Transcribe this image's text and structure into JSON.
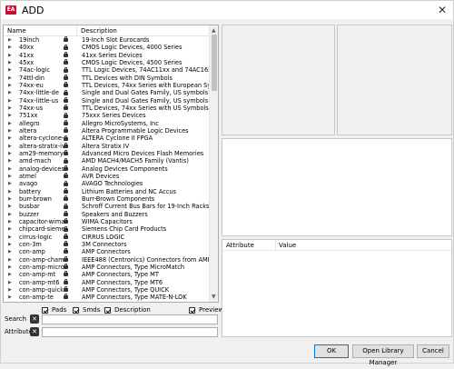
{
  "window": {
    "title": "ADD",
    "close": "✕"
  },
  "library_list": {
    "columns": {
      "name": "Name",
      "description": "Description"
    },
    "rows": [
      {
        "name": "19inch",
        "description": "19-Inch Slot Eurocards"
      },
      {
        "name": "40xx",
        "description": "CMOS Logic Devices, 4000 Series"
      },
      {
        "name": "41xx",
        "description": "41xx Series Devices"
      },
      {
        "name": "45xx",
        "description": "CMOS Logic Devices, 4500 Series"
      },
      {
        "name": "74ac-logic",
        "description": "TTL Logic Devices, 74AC11xx and 74AC16xx Series"
      },
      {
        "name": "74ttl-din",
        "description": "TTL Devices with DIN Symbols"
      },
      {
        "name": "74xx-eu",
        "description": "TTL Devices, 74xx Series with European Symbols"
      },
      {
        "name": "74xx-little-de",
        "description": "Single and Dual Gates Family, US symbols"
      },
      {
        "name": "74xx-little-us",
        "description": "Single and Dual Gates Family, US symbols"
      },
      {
        "name": "74xx-us",
        "description": "TTL Devices, 74xx Series with US Symbols"
      },
      {
        "name": "751xx",
        "description": "75xxx Series Devices"
      },
      {
        "name": "allegro",
        "description": "Allegro MicroSystems, Inc"
      },
      {
        "name": "altera",
        "description": "Altera Programmable Logic Devices"
      },
      {
        "name": "altera-cyclone-II",
        "description": "ALTERA Cyclone II FPGA"
      },
      {
        "name": "altera-stratix-iv",
        "description": "Altera Stratix IV"
      },
      {
        "name": "am29-memory",
        "description": "Advanced Micro Devices Flash Memories"
      },
      {
        "name": "amd-mach",
        "description": "AMD MACH4/MACH5 Family (Vantis)"
      },
      {
        "name": "analog-devices",
        "description": "Analog Devices Components"
      },
      {
        "name": "atmel",
        "description": "AVR Devices"
      },
      {
        "name": "avago",
        "description": "AVAGO Technologies"
      },
      {
        "name": "battery",
        "description": "Lithium Batteries and NC Accus"
      },
      {
        "name": "burr-brown",
        "description": "Burr-Brown Components"
      },
      {
        "name": "busbar",
        "description": "Schroff Current Bus Bars for 19-Inch Racks"
      },
      {
        "name": "buzzer",
        "description": "Speakers and Buzzers"
      },
      {
        "name": "capacitor-wima",
        "description": "WIMA Capacitors"
      },
      {
        "name": "chipcard-siemens",
        "description": "Siemens Chip Card Products"
      },
      {
        "name": "cirrus-logic",
        "description": "CIRRUS LOGIC"
      },
      {
        "name": "con-3m",
        "description": "3M Connectors"
      },
      {
        "name": "con-amp",
        "description": "AMP Connectors"
      },
      {
        "name": "con-amp-champ",
        "description": "IEEE488 (Centronics) Connectors from AMP"
      },
      {
        "name": "con-amp-micro...",
        "description": "AMP Connectors, Type MicroMatch"
      },
      {
        "name": "con-amp-mt",
        "description": "AMP Connectors, Type MT"
      },
      {
        "name": "con-amp-mt6",
        "description": "AMP Connectors, Type MT6"
      },
      {
        "name": "con-amp-quick",
        "description": "AMP Connectors, Type QUICK"
      },
      {
        "name": "con-amp-te",
        "description": "AMP Connectors, Type MATE-N-LOK"
      }
    ]
  },
  "filters": {
    "pads": "Pads",
    "smds": "Smds",
    "description": "Description",
    "preview": "Preview"
  },
  "search": {
    "label": "Search",
    "value": ""
  },
  "attributes": {
    "label": "Attributes",
    "value": ""
  },
  "attribute_table": {
    "col_attribute": "Attribute",
    "col_value": "Value"
  },
  "buttons": {
    "ok": "OK",
    "open_library_manager": "Open Library Manager",
    "cancel": "Cancel"
  }
}
